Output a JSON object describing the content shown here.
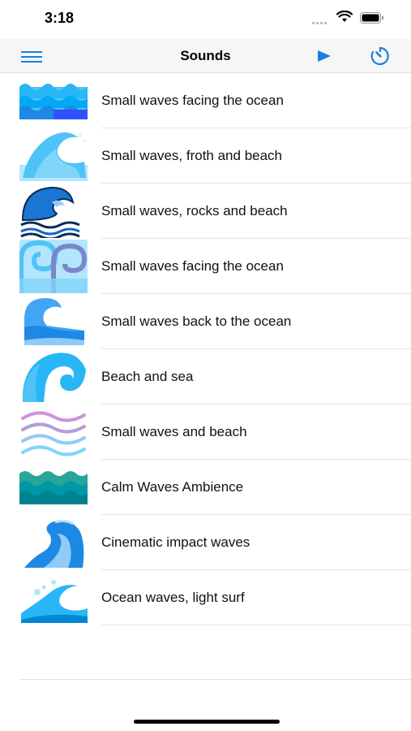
{
  "status_bar": {
    "time": "3:18"
  },
  "nav": {
    "title": "Sounds"
  },
  "sounds": [
    {
      "label": "Small waves facing the ocean"
    },
    {
      "label": "Small waves, froth and beach"
    },
    {
      "label": "Small waves, rocks and beach"
    },
    {
      "label": "Small waves facing the ocean"
    },
    {
      "label": "Small waves back to the ocean"
    },
    {
      "label": "Beach and sea"
    },
    {
      "label": "Small waves and beach"
    },
    {
      "label": "Calm Waves Ambience"
    },
    {
      "label": "Cinematic impact waves"
    },
    {
      "label": "Ocean waves, light surf"
    }
  ],
  "colors": {
    "accent": "#1a7fe0",
    "nav_background": "#f6f6f7",
    "separator": "#e4e4e6"
  }
}
